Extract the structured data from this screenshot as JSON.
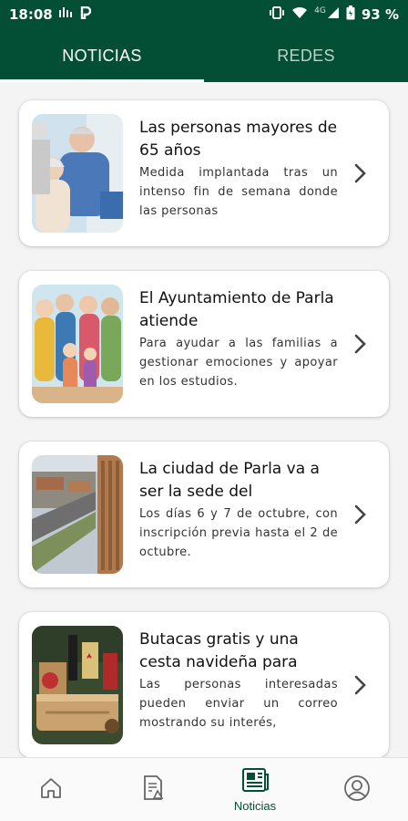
{
  "status_bar": {
    "time": "18:08",
    "network": "4G",
    "battery": "93 %"
  },
  "tabs": [
    {
      "label": "NOTICIAS",
      "active": true
    },
    {
      "label": "REDES",
      "active": false
    }
  ],
  "news": [
    {
      "title": "Las personas mayores de 65 años",
      "description": "Medida implantada tras un intenso fin de semana donde las personas"
    },
    {
      "title": "El Ayuntamiento de Parla atiende",
      "description": "Para ayudar a las familias a gestionar emociones y apoyar en los estudios."
    },
    {
      "title": "La ciudad de Parla va a ser la sede del",
      "description": "Los días 6 y 7 de octubre, con inscripción previa hasta el 2 de octubre."
    },
    {
      "title": "Butacas gratis y una cesta navideña para",
      "description": "Las personas interesadas pueden enviar un correo mostrando su interés,"
    }
  ],
  "bottom_nav": {
    "noticias_label": "Noticias"
  },
  "colors": {
    "brand_green": "#024f35",
    "tab_inactive": "#b9d4c6"
  }
}
